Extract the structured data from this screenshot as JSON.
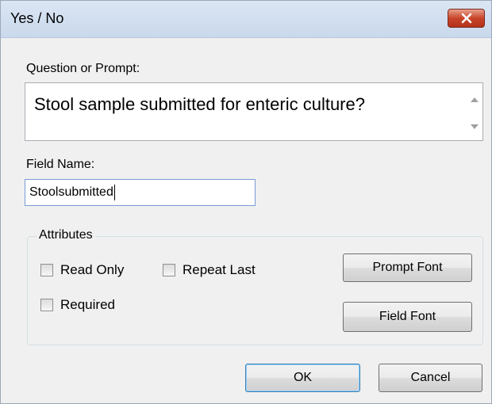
{
  "window": {
    "title": "Yes / No",
    "close_icon": "close-icon"
  },
  "prompt": {
    "label": "Question or Prompt:",
    "value": "Stool sample submitted for enteric culture?"
  },
  "field": {
    "label": "Field Name:",
    "value": "Stoolsubmitted"
  },
  "attributes": {
    "legend": "Attributes",
    "read_only": "Read Only",
    "repeat_last": "Repeat Last",
    "required": "Required",
    "prompt_font": "Prompt Font",
    "field_font": "Field Font"
  },
  "buttons": {
    "ok": "OK",
    "cancel": "Cancel"
  },
  "colors": {
    "close_button": "#c7452a",
    "titlebar": "#d4e1f2",
    "dialog_bg": "#f0f0f0"
  }
}
